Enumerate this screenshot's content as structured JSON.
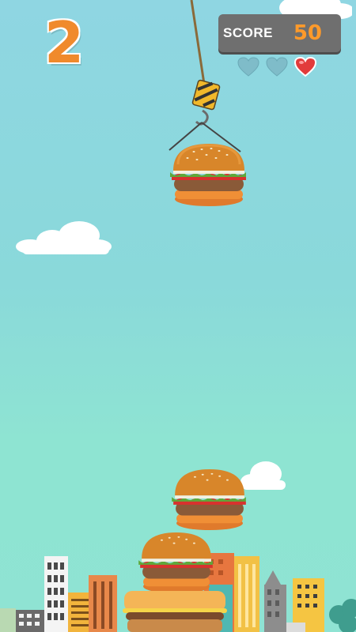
{
  "hud": {
    "level": "2",
    "score_label": "SCORE",
    "score_value": "50",
    "lives": {
      "total": 3,
      "remaining": 1
    }
  },
  "game": {
    "crane_item": "burger",
    "stack": [
      "bun-base",
      "burger",
      "burger"
    ]
  },
  "colors": {
    "accent": "#f08a2c",
    "score_value": "#ff9a2a",
    "heart_full": "#e23b3b",
    "heart_empty": "#7fbcc9",
    "panel": "#6f6f6f"
  },
  "icons": [
    "heart-empty-icon",
    "heart-empty-icon",
    "heart-full-icon",
    "crane-hook-icon"
  ]
}
